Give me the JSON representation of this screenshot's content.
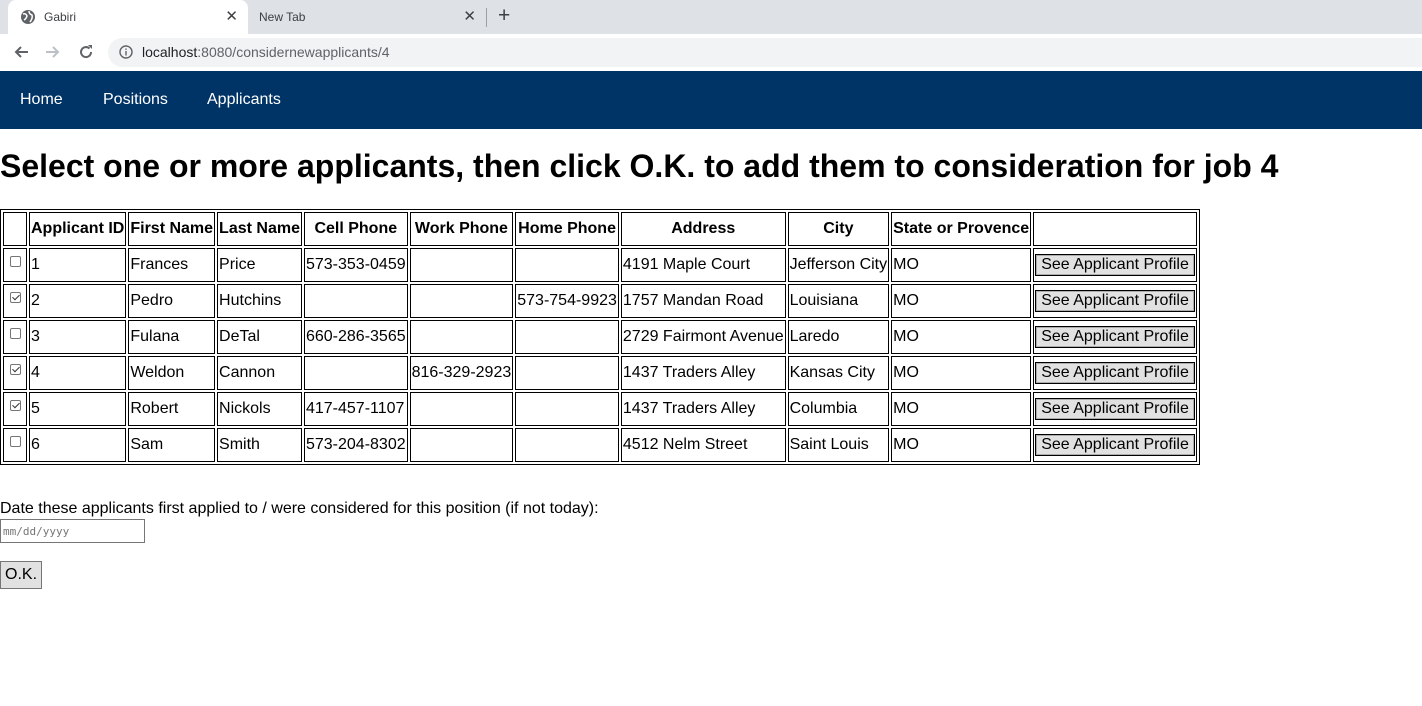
{
  "browser": {
    "tabs": [
      {
        "title": "Gabiri",
        "active": true,
        "icon": "globe-icon"
      },
      {
        "title": "New Tab",
        "active": false
      }
    ],
    "url_host": "localhost",
    "url_rest": ":8080/considernewapplicants/4"
  },
  "nav": {
    "items": [
      "Home",
      "Positions",
      "Applicants"
    ],
    "background": "#003366"
  },
  "page": {
    "heading": "Select one or more applicants, then click O.K. to add them to consideration for job 4",
    "columns": [
      "",
      "Applicant ID",
      "First Name",
      "Last Name",
      "Cell Phone",
      "Work Phone",
      "Home Phone",
      "Address",
      "City",
      "State or Provence",
      ""
    ],
    "profile_button_label": "See Applicant Profile",
    "applicants": [
      {
        "checked": false,
        "id": "1",
        "first": "Frances",
        "last": "Price",
        "cell": "573-353-0459",
        "work": "",
        "home": "",
        "address": "4191 Maple Court",
        "city": "Jefferson City",
        "state": "MO"
      },
      {
        "checked": true,
        "id": "2",
        "first": "Pedro",
        "last": "Hutchins",
        "cell": "",
        "work": "",
        "home": "573-754-9923",
        "address": "1757 Mandan Road",
        "city": "Louisiana",
        "state": "MO"
      },
      {
        "checked": false,
        "id": "3",
        "first": "Fulana",
        "last": "DeTal",
        "cell": "660-286-3565",
        "work": "",
        "home": "",
        "address": "2729 Fairmont Avenue",
        "city": "Laredo",
        "state": "MO"
      },
      {
        "checked": true,
        "id": "4",
        "first": "Weldon",
        "last": "Cannon",
        "cell": "",
        "work": "816-329-2923",
        "home": "",
        "address": "1437 Traders Alley",
        "city": "Kansas City",
        "state": "MO"
      },
      {
        "checked": true,
        "id": "5",
        "first": "Robert",
        "last": "Nickols",
        "cell": "417-457-1107",
        "work": "",
        "home": "",
        "address": "1437 Traders Alley",
        "city": "Columbia",
        "state": "MO"
      },
      {
        "checked": false,
        "id": "6",
        "first": "Sam",
        "last": "Smith",
        "cell": "573-204-8302",
        "work": "",
        "home": "",
        "address": "4512 Nelm Street",
        "city": "Saint Louis",
        "state": "MO"
      }
    ],
    "date_label": "Date these applicants first applied to / were considered for this position (if not today):",
    "date_placeholder": "mm/dd/yyyy",
    "ok_label": "O.K."
  }
}
